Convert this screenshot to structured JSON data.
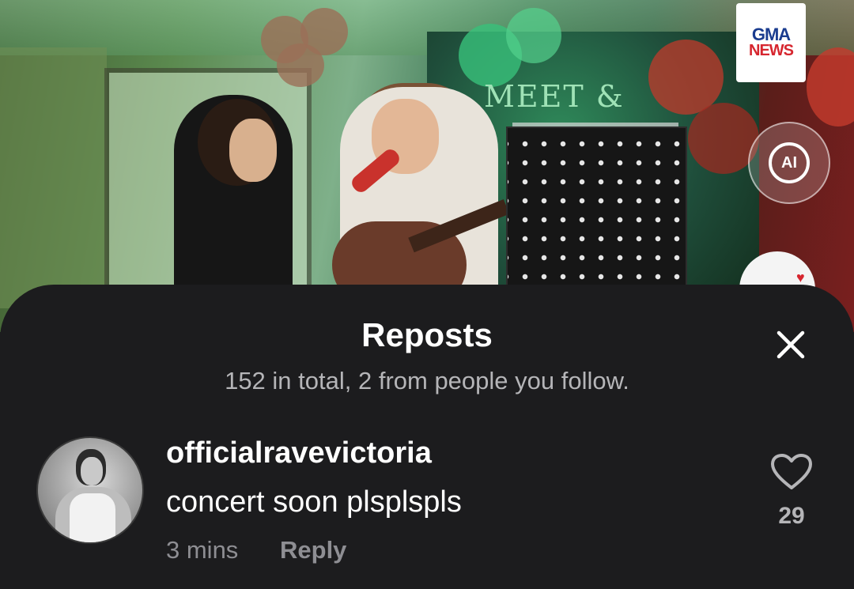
{
  "overlay": {
    "logo_top": "GMA",
    "logo_bottom": "NEWS",
    "ai_badge": "AI",
    "backdrop_text": "MEET &"
  },
  "sheet": {
    "title": "Reposts",
    "subtitle": "152 in total, 2 from people you follow.",
    "close_icon": "close-icon"
  },
  "comments": [
    {
      "username": "officialravevictoria",
      "text": "concert soon plsplspls",
      "time": "3 mins",
      "reply_label": "Reply",
      "likes": "29",
      "like_icon": "heart-outline-icon"
    }
  ],
  "colors": {
    "sheet_bg": "#1c1c1e",
    "primary_text": "#ffffff",
    "secondary_text": "#8e8e93"
  }
}
